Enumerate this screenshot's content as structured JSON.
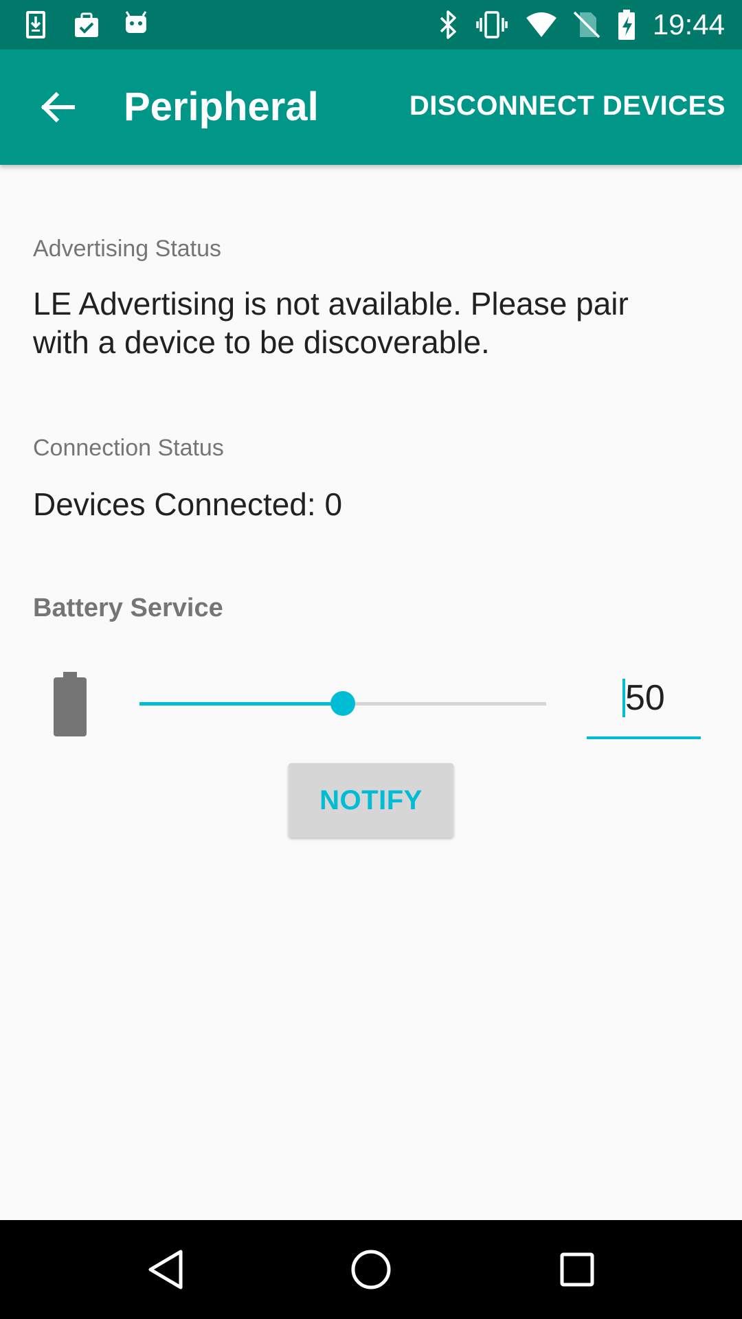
{
  "status_bar": {
    "time": "19:44",
    "left_icons": [
      "download-icon",
      "clipboard-check-icon",
      "android-icon"
    ],
    "right_icons": [
      "bluetooth-icon",
      "vibrate-icon",
      "wifi-icon",
      "no-sim-icon",
      "battery-charging-icon"
    ]
  },
  "app_bar": {
    "title": "Peripheral",
    "action_label": "DISCONNECT DEVICES",
    "back_icon": "arrow-back-icon"
  },
  "advertising": {
    "label": "Advertising Status",
    "value": "LE Advertising is not available. Please pair with a device to be discoverable."
  },
  "connection": {
    "label": "Connection Status",
    "value": "Devices Connected: 0"
  },
  "battery": {
    "header": "Battery Service",
    "icon": "battery-icon",
    "level": 50,
    "level_text": "50",
    "slider_max": 100,
    "notify_label": "NOTIFY"
  },
  "nav_bar": {
    "buttons": [
      "back-nav-icon",
      "home-nav-icon",
      "recents-nav-icon"
    ]
  },
  "colors": {
    "status_bar": "#00796b",
    "app_bar": "#009688",
    "accent": "#00bcd4",
    "background": "#fafafa",
    "label_grey": "#757575",
    "text": "#212121"
  }
}
